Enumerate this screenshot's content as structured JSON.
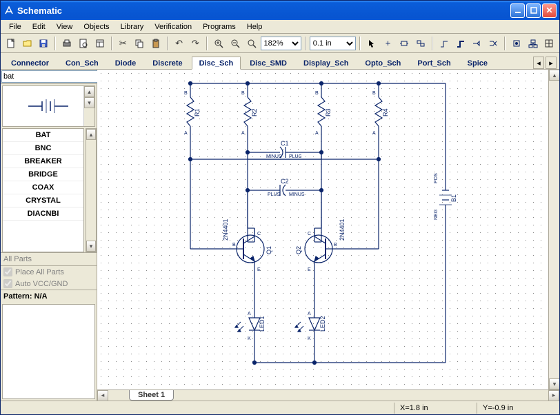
{
  "window": {
    "title": "Schematic"
  },
  "menu": {
    "file": "File",
    "edit": "Edit",
    "view": "View",
    "objects": "Objects",
    "library": "Library",
    "verification": "Verification",
    "programs": "Programs",
    "help": "Help"
  },
  "toolbar": {
    "zoom_value": "182%",
    "units_value": "0.1 in"
  },
  "tabs": {
    "items": [
      {
        "label": "Connector"
      },
      {
        "label": "Con_Sch"
      },
      {
        "label": "Diode"
      },
      {
        "label": "Discrete"
      },
      {
        "label": "Disc_Sch",
        "active": true
      },
      {
        "label": "Disc_SMD"
      },
      {
        "label": "Display_Sch"
      },
      {
        "label": "Opto_Sch"
      },
      {
        "label": "Port_Sch"
      },
      {
        "label": "Spice"
      }
    ]
  },
  "sidebar": {
    "search_value": "bat",
    "parts": [
      {
        "label": "BAT"
      },
      {
        "label": "BNC"
      },
      {
        "label": "BREAKER"
      },
      {
        "label": "BRIDGE"
      },
      {
        "label": "COAX"
      },
      {
        "label": "CRYSTAL"
      },
      {
        "label": "DIACNBI"
      }
    ],
    "filter_label": "All Parts",
    "place_all": "Place All Parts",
    "auto_vcc": "Auto VCC/GND",
    "pattern": "Pattern: N/A"
  },
  "schematic": {
    "components": {
      "r1": "R1",
      "r2": "R2",
      "r3": "R3",
      "r4": "R4",
      "c1": "C1",
      "c2": "C2",
      "q1": "Q1",
      "q2": "Q2",
      "q1_type": "2N4401",
      "q2_type": "2N4401",
      "led1": "LED1",
      "led2": "LED2",
      "b1": "B1",
      "pin_a": "A",
      "pin_b": "B",
      "pin_c": "C",
      "pin_e": "E",
      "pin_k": "K",
      "plus": "PLUS",
      "minus": "MINUS",
      "pos": "POS",
      "neg": "NEG"
    }
  },
  "sheet": {
    "name": "Sheet 1"
  },
  "status": {
    "x": "X=1.8 in",
    "y": "Y=-0.9 in"
  }
}
